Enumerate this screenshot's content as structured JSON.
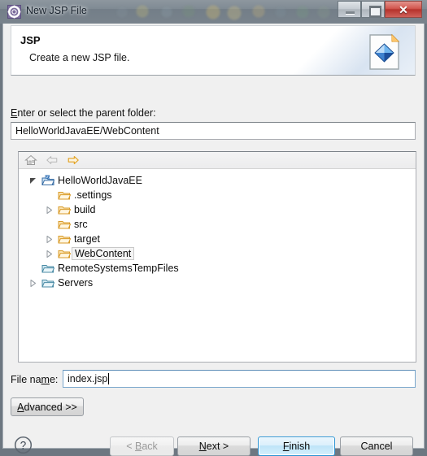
{
  "window": {
    "title": "New JSP File",
    "icon": "eclipse-wizard-icon",
    "buttons": {
      "minimize": "minimize",
      "maximize": "maximize",
      "close": "✕"
    }
  },
  "header": {
    "title": "JSP",
    "subtitle": "Create a new JSP file.",
    "icon": "jsp-file-icon"
  },
  "parent_folder": {
    "label_pre": "E",
    "label_post": "nter or select the parent folder:",
    "value": "HelloWorldJavaEE/WebContent"
  },
  "tree_toolbar": {
    "home": "home-icon",
    "back": "back-arrow-icon",
    "forward": "forward-arrow-icon"
  },
  "tree": {
    "items": [
      {
        "label": "HelloWorldJavaEE",
        "indent": 0,
        "twisty": "expanded",
        "icon": "project-icon",
        "selected": false
      },
      {
        "label": ".settings",
        "indent": 1,
        "twisty": "none",
        "icon": "folder-icon",
        "selected": false
      },
      {
        "label": "build",
        "indent": 1,
        "twisty": "collapsed",
        "icon": "folder-icon",
        "selected": false
      },
      {
        "label": "src",
        "indent": 1,
        "twisty": "none",
        "icon": "folder-icon",
        "selected": false
      },
      {
        "label": "target",
        "indent": 1,
        "twisty": "collapsed",
        "icon": "folder-icon",
        "selected": false
      },
      {
        "label": "WebContent",
        "indent": 1,
        "twisty": "collapsed",
        "icon": "folder-icon",
        "selected": true
      },
      {
        "label": "RemoteSystemsTempFiles",
        "indent": 0,
        "twisty": "none",
        "icon": "folder-blue-icon",
        "selected": false
      },
      {
        "label": "Servers",
        "indent": 0,
        "twisty": "collapsed",
        "icon": "folder-blue-icon",
        "selected": false
      }
    ]
  },
  "file_name": {
    "label_pre": "File na",
    "label_mid": "m",
    "label_post": "e:",
    "value": "index.jsp"
  },
  "advanced_button": {
    "pre": "A",
    "mid": "dvanced >>",
    "full": "Advanced >>"
  },
  "footer": {
    "help": "?",
    "back": {
      "pre": "< ",
      "mid": "B",
      "post": "ack",
      "disabled": true
    },
    "next": {
      "pre": "",
      "mid": "N",
      "post": "ext >",
      "disabled": false
    },
    "finish": {
      "pre": "",
      "mid": "F",
      "post": "inish",
      "default": true
    },
    "cancel": {
      "pre": "",
      "mid": "",
      "post": "Cancel"
    }
  },
  "colors": {
    "accent_blue": "#2b94d4",
    "folder_orange": "#e8a33d",
    "dialog_bg": "#f0f0f0",
    "close_red": "#b5332c"
  }
}
